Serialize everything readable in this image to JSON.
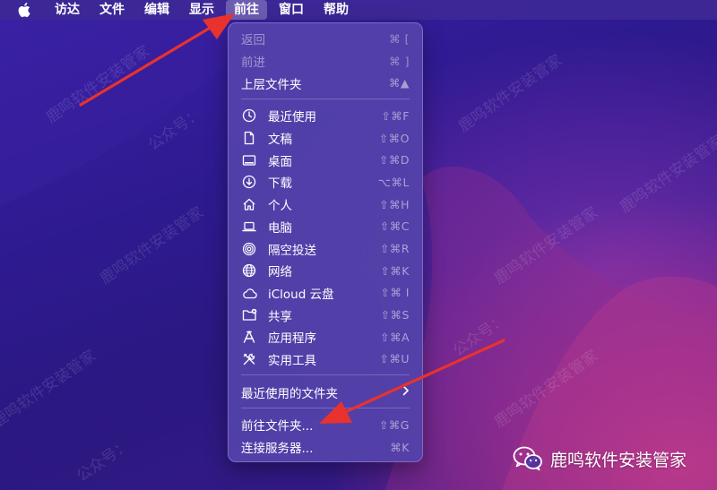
{
  "menubar": {
    "apple_icon": "apple-logo-icon",
    "items": [
      {
        "label": "访达"
      },
      {
        "label": "文件"
      },
      {
        "label": "编辑"
      },
      {
        "label": "显示"
      },
      {
        "label": "前往",
        "active": true
      },
      {
        "label": "窗口"
      },
      {
        "label": "帮助"
      }
    ]
  },
  "go_menu": {
    "nav": [
      {
        "label": "返回",
        "shortcut": "⌘ [",
        "disabled": true
      },
      {
        "label": "前进",
        "shortcut": "⌘ ]",
        "disabled": true
      },
      {
        "label": "上层文件夹",
        "shortcut": "⌘▲",
        "disabled": false
      }
    ],
    "places": [
      {
        "label": "最近使用",
        "shortcut": "⇧⌘F",
        "icon": "clock-icon"
      },
      {
        "label": "文稿",
        "shortcut": "⇧⌘O",
        "icon": "document-icon"
      },
      {
        "label": "桌面",
        "shortcut": "⇧⌘D",
        "icon": "desktop-icon"
      },
      {
        "label": "下载",
        "shortcut": "⌥⌘L",
        "icon": "download-icon"
      },
      {
        "label": "个人",
        "shortcut": "⇧⌘H",
        "icon": "home-icon"
      },
      {
        "label": "电脑",
        "shortcut": "⇧⌘C",
        "icon": "laptop-icon"
      },
      {
        "label": "隔空投送",
        "shortcut": "⇧⌘R",
        "icon": "airdrop-icon"
      },
      {
        "label": "网络",
        "shortcut": "⇧⌘K",
        "icon": "network-globe-icon"
      },
      {
        "label": "iCloud 云盘",
        "shortcut": "⇧⌘ I",
        "icon": "cloud-icon"
      },
      {
        "label": "共享",
        "shortcut": "⇧⌘S",
        "icon": "shared-folder-icon"
      },
      {
        "label": "应用程序",
        "shortcut": "⇧⌘A",
        "icon": "applications-icon"
      },
      {
        "label": "实用工具",
        "shortcut": "⇧⌘U",
        "icon": "tools-icon"
      }
    ],
    "recent_folders": {
      "label": "最近使用的文件夹",
      "icon": "chevron-right-icon"
    },
    "goto_folder": {
      "label": "前往文件夹...",
      "shortcut": "⇧⌘G"
    },
    "connect_server": {
      "label": "连接服务器...",
      "shortcut": "⌘K"
    }
  },
  "watermark": {
    "text_a": "鹿鸣软件安装管家",
    "text_b": "公众号："
  },
  "brand": {
    "icon": "wechat-icon",
    "label": "鹿鸣软件安装管家"
  },
  "colors": {
    "menu_bg": "#5442aa",
    "annotation_arrow": "#e8322e",
    "active_menu_highlight": "#ffffff40"
  }
}
